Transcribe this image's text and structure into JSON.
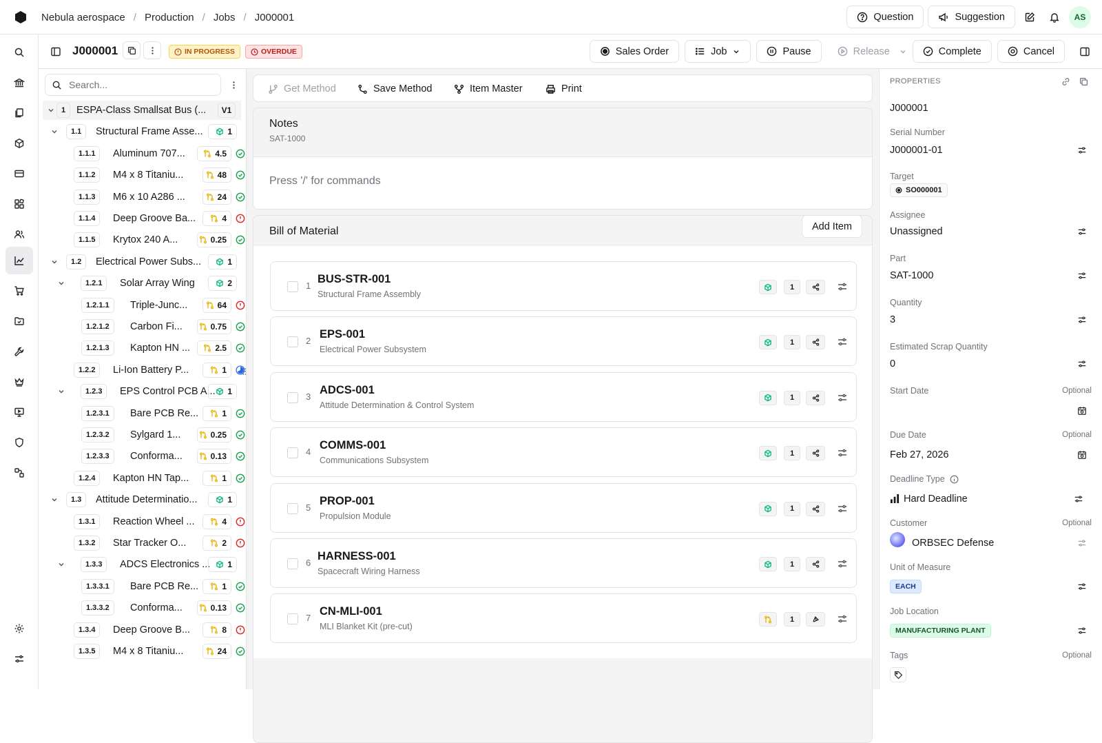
{
  "topbar": {
    "breadcrumb": [
      "Nebula aerospace",
      "Production",
      "Jobs",
      "J000001"
    ],
    "question_label": "Question",
    "suggestion_label": "Suggestion",
    "avatar_initials": "AS"
  },
  "job": {
    "id": "J000001",
    "status_badge": "IN PROGRESS",
    "overdue_badge": "OVERDUE",
    "buttons": {
      "sales_order": "Sales Order",
      "job": "Job",
      "pause": "Pause",
      "release": "Release",
      "complete": "Complete",
      "cancel": "Cancel"
    }
  },
  "tree": {
    "search_placeholder": "Search...",
    "rows": [
      {
        "num": "1",
        "label": "ESPA-Class Smallsat Bus (...",
        "qty": "V1",
        "kind": "version",
        "status": "",
        "level": 0,
        "expand": true
      },
      {
        "num": "1.1",
        "label": "Structural Frame Asse...",
        "qty": "1",
        "kind": "make",
        "status": "",
        "level": 1,
        "expand": true
      },
      {
        "num": "1.1.1",
        "label": "Aluminum 707...",
        "qty": "4.5",
        "kind": "buy",
        "status": "ok",
        "level": 2,
        "expand": false
      },
      {
        "num": "1.1.2",
        "label": "M4 x 8 Titaniu...",
        "qty": "48",
        "kind": "buy",
        "status": "ok",
        "level": 2,
        "expand": false
      },
      {
        "num": "1.1.3",
        "label": "M6 x 10 A286 ...",
        "qty": "24",
        "kind": "buy",
        "status": "ok",
        "level": 2,
        "expand": false
      },
      {
        "num": "1.1.4",
        "label": "Deep Groove Ba...",
        "qty": "4",
        "kind": "buy",
        "status": "error",
        "level": 2,
        "expand": false
      },
      {
        "num": "1.1.5",
        "label": "Krytox 240 A...",
        "qty": "0.25",
        "kind": "buy",
        "status": "ok",
        "level": 2,
        "expand": false
      },
      {
        "num": "1.2",
        "label": "Electrical Power Subs...",
        "qty": "1",
        "kind": "make",
        "status": "",
        "level": 1,
        "expand": true
      },
      {
        "num": "1.2.1",
        "label": "Solar Array Wing",
        "qty": "2",
        "kind": "make",
        "status": "",
        "level": 2,
        "expand": true
      },
      {
        "num": "1.2.1.1",
        "label": "Triple-Junc...",
        "qty": "64",
        "kind": "buy",
        "status": "error",
        "level": 3,
        "expand": false
      },
      {
        "num": "1.2.1.2",
        "label": "Carbon Fi...",
        "qty": "0.75",
        "kind": "buy",
        "status": "ok",
        "level": 3,
        "expand": false
      },
      {
        "num": "1.2.1.3",
        "label": "Kapton HN ...",
        "qty": "2.5",
        "kind": "buy",
        "status": "ok",
        "level": 3,
        "expand": false
      },
      {
        "num": "1.2.2",
        "label": "Li-Ion Battery P...",
        "qty": "1",
        "kind": "buy",
        "status": "progress",
        "level": 2,
        "expand": false
      },
      {
        "num": "1.2.3",
        "label": "EPS Control PCB A...",
        "qty": "1",
        "kind": "make",
        "status": "",
        "level": 2,
        "expand": true
      },
      {
        "num": "1.2.3.1",
        "label": "Bare PCB Re...",
        "qty": "1",
        "kind": "buy",
        "status": "ok",
        "level": 3,
        "expand": false
      },
      {
        "num": "1.2.3.2",
        "label": "Sylgard 1...",
        "qty": "0.25",
        "kind": "buy",
        "status": "ok",
        "level": 3,
        "expand": false
      },
      {
        "num": "1.2.3.3",
        "label": "Conforma...",
        "qty": "0.13",
        "kind": "buy",
        "status": "ok",
        "level": 3,
        "expand": false
      },
      {
        "num": "1.2.4",
        "label": "Kapton HN Tap...",
        "qty": "1",
        "kind": "buy",
        "status": "ok",
        "level": 2,
        "expand": false
      },
      {
        "num": "1.3",
        "label": "Attitude Determinatio...",
        "qty": "1",
        "kind": "make",
        "status": "",
        "level": 1,
        "expand": true
      },
      {
        "num": "1.3.1",
        "label": "Reaction Wheel ...",
        "qty": "4",
        "kind": "buy",
        "status": "error",
        "level": 2,
        "expand": false
      },
      {
        "num": "1.3.2",
        "label": "Star Tracker O...",
        "qty": "2",
        "kind": "buy",
        "status": "error",
        "level": 2,
        "expand": false
      },
      {
        "num": "1.3.3",
        "label": "ADCS Electronics ...",
        "qty": "1",
        "kind": "make",
        "status": "",
        "level": 2,
        "expand": true
      },
      {
        "num": "1.3.3.1",
        "label": "Bare PCB Re...",
        "qty": "1",
        "kind": "buy",
        "status": "ok",
        "level": 3,
        "expand": false
      },
      {
        "num": "1.3.3.2",
        "label": "Conforma...",
        "qty": "0.13",
        "kind": "buy",
        "status": "ok",
        "level": 3,
        "expand": false
      },
      {
        "num": "1.3.4",
        "label": "Deep Groove B...",
        "qty": "8",
        "kind": "buy",
        "status": "error",
        "level": 2,
        "expand": false
      },
      {
        "num": "1.3.5",
        "label": "M4 x 8 Titaniu...",
        "qty": "24",
        "kind": "buy",
        "status": "ok",
        "level": 2,
        "expand": false
      }
    ]
  },
  "toolbar": {
    "get_method": "Get Method",
    "save_method": "Save Method",
    "item_master": "Item Master",
    "print": "Print"
  },
  "notes": {
    "title": "Notes",
    "subtitle": "SAT-1000",
    "placeholder": "Press '/' for commands"
  },
  "bom": {
    "title": "Bill of Material",
    "add_item": "Add Item",
    "items": [
      {
        "index": "1",
        "id": "BUS-STR-001",
        "desc": "Structural Frame Assembly",
        "qty": "1",
        "kind": "make"
      },
      {
        "index": "2",
        "id": "EPS-001",
        "desc": "Electrical Power Subsystem",
        "qty": "1",
        "kind": "make"
      },
      {
        "index": "3",
        "id": "ADCS-001",
        "desc": "Attitude Determination & Control System",
        "qty": "1",
        "kind": "make"
      },
      {
        "index": "4",
        "id": "COMMS-001",
        "desc": "Communications Subsystem",
        "qty": "1",
        "kind": "make"
      },
      {
        "index": "5",
        "id": "PROP-001",
        "desc": "Propulsion Module",
        "qty": "1",
        "kind": "make"
      },
      {
        "index": "6",
        "id": "HARNESS-001",
        "desc": "Spacecraft Wiring Harness",
        "qty": "1",
        "kind": "make"
      },
      {
        "index": "7",
        "id": "CN-MLI-001",
        "desc": "MLI Blanket Kit (pre-cut)",
        "qty": "1",
        "kind": "buy"
      }
    ]
  },
  "properties": {
    "header": "PROPERTIES",
    "job_id": "J000001",
    "serial_label": "Serial Number",
    "serial_value": "J000001-01",
    "target_label": "Target",
    "target_value": "SO000001",
    "assignee_label": "Assignee",
    "assignee_value": "Unassigned",
    "part_label": "Part",
    "part_value": "SAT-1000",
    "quantity_label": "Quantity",
    "quantity_value": "3",
    "scrap_label": "Estimated Scrap Quantity",
    "scrap_value": "0",
    "start_label": "Start Date",
    "due_label": "Due Date",
    "due_value": "Feb 27, 2026",
    "deadline_label": "Deadline Type",
    "deadline_value": "Hard Deadline",
    "customer_label": "Customer",
    "customer_value": "ORBSEC Defense",
    "uom_label": "Unit of Measure",
    "uom_value": "EACH",
    "location_label": "Job Location",
    "location_value": "MANUFACTURING PLANT",
    "tags_label": "Tags",
    "optional": "Optional"
  },
  "colors": {
    "make": "#10b981",
    "buy": "#eab308",
    "ok": "#16a34a",
    "error": "#dc2626",
    "progress": "#2563eb",
    "in_progress_bg": "#fef3c7",
    "overdue_bg": "#fee2e2",
    "uom_bg": "#dbeafe",
    "location_bg": "#dcfce7"
  }
}
